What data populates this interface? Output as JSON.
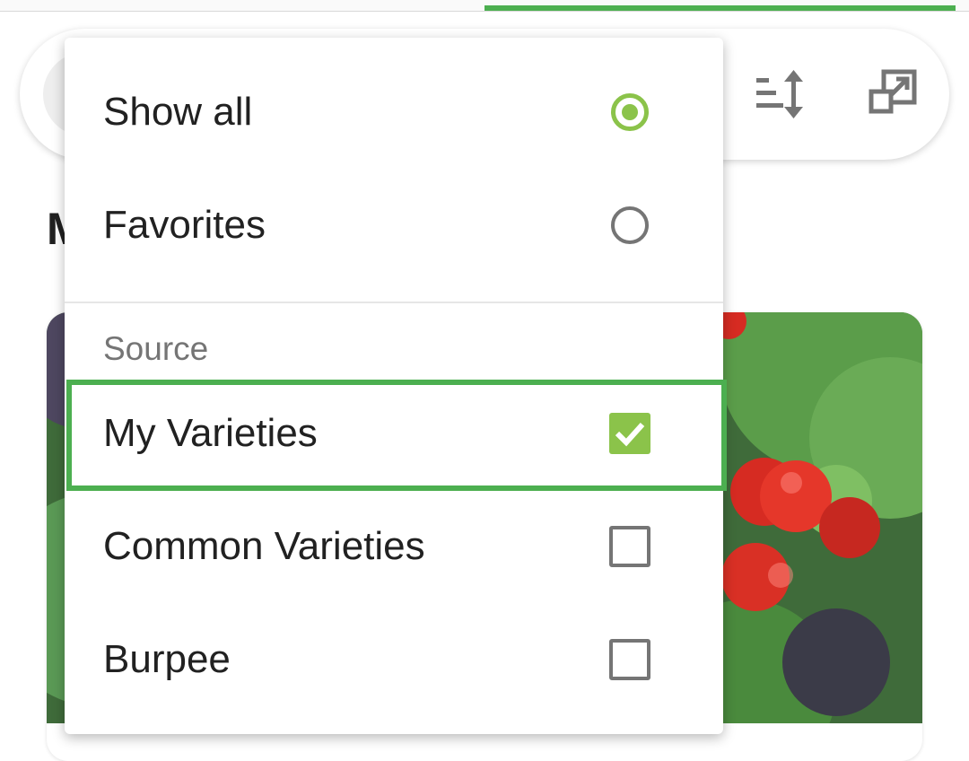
{
  "colors": {
    "accent": "#4caf50",
    "control_active": "#8bc34a",
    "control_inactive": "#757575"
  },
  "toolbar": {
    "sort_icon": "sort-icon",
    "expand_icon": "open-in-new-window-icon"
  },
  "page": {
    "heading_partial": "M"
  },
  "menu": {
    "view_options": [
      {
        "label": "Show all",
        "selected": true
      },
      {
        "label": "Favorites",
        "selected": false
      }
    ],
    "source_section_label": "Source",
    "source_options": [
      {
        "label": "My Varieties",
        "checked": true
      },
      {
        "label": "Common Varieties",
        "checked": false
      },
      {
        "label": "Burpee",
        "checked": false
      }
    ]
  }
}
